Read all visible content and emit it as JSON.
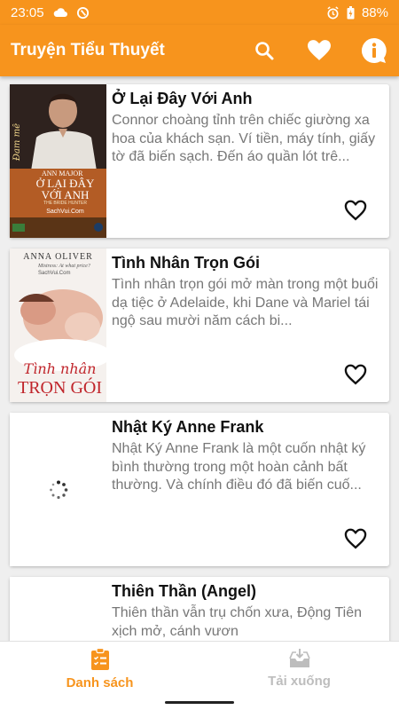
{
  "status_bar": {
    "time": "23:05",
    "battery": "88%"
  },
  "app_bar": {
    "title": "Truyện Tiểu Thuyết",
    "actions": [
      "search-icon",
      "heart-icon",
      "info-icon"
    ]
  },
  "books": [
    {
      "title": "Ở Lại Đây Với Anh",
      "description": "Connor choàng tỉnh trên chiếc giường xa hoa của khách sạn. Ví tiền, máy tính, giấy tờ đã biến sạch. Đến áo quần lót trê...",
      "cover": {
        "genre": "Đam mê",
        "author": "ANN MAJOR",
        "title_line1": "Ở LẠI ĐÂY",
        "title_line2": "VỚI ANH",
        "series": "THE BRIDE HUNTER",
        "site": "SachVui.Com"
      }
    },
    {
      "title": "Tình Nhân Trọn Gói",
      "description": "Tình nhân trọn gói mở màn trong một buổi dạ tiệc ở Adelaide, khi Dane và Mariel tái ngộ sau mười năm cách bi...",
      "cover": {
        "author": "ANNA OLIVER",
        "tagline": "Mistress: At what price?",
        "site": "SachVui.Com",
        "title_line1": "Tình nhân",
        "title_line2": "TRỌN GÓI"
      }
    },
    {
      "title": "Nhật Ký Anne Frank",
      "description": "Nhật Ký Anne Frank là một cuốn nhật ký bình thường trong một hoàn cảnh bất thường. Và chính điều đó đã biến cuố..."
    },
    {
      "title": "Thiên Thần (Angel)",
      "description": "Thiên thần vẫn trụ chốn xưa, Động Tiên xịch mở, cánh vươn"
    }
  ],
  "bottom_nav": {
    "items": [
      {
        "label": "Danh sách",
        "icon": "clipboard-list-icon",
        "active": true
      },
      {
        "label": "Tải xuống",
        "icon": "download-tray-icon",
        "active": false
      }
    ]
  },
  "colors": {
    "primary": "#f7941d",
    "inactive": "#bdbdbd"
  }
}
